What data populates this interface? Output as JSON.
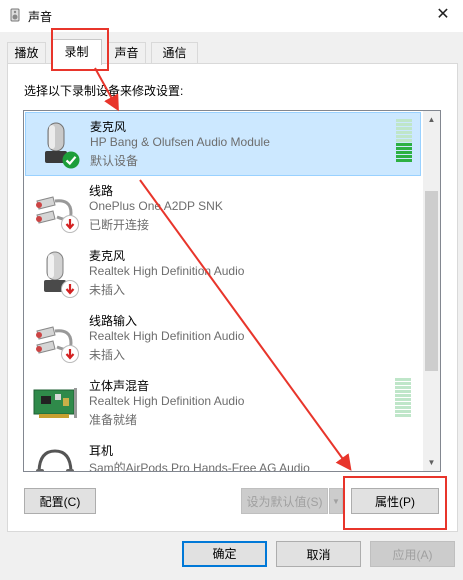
{
  "window": {
    "title": "声音",
    "close_glyph": "✕"
  },
  "tabs": [
    {
      "label": "播放"
    },
    {
      "label": "录制"
    },
    {
      "label": "声音"
    },
    {
      "label": "通信"
    }
  ],
  "instruction": "选择以下录制设备来修改设置:",
  "devices": [
    {
      "name": "麦克风",
      "description": "HP Bang & Olufsen Audio Module",
      "status": "默认设备",
      "icon": "microphone-icon",
      "badge": "check-badge-icon",
      "selected": true,
      "meter_level": 0.4
    },
    {
      "name": "线路",
      "description": "OnePlus One A2DP SNK",
      "status": "已断开连接",
      "icon": "line-in-icon",
      "badge": "down-arrow-badge-icon",
      "selected": false
    },
    {
      "name": "麦克风",
      "description": "Realtek High Definition Audio",
      "status": "未插入",
      "icon": "microphone-icon",
      "badge": "down-arrow-badge-icon",
      "selected": false
    },
    {
      "name": "线路输入",
      "description": "Realtek High Definition Audio",
      "status": "未插入",
      "icon": "line-in-icon",
      "badge": "down-arrow-badge-icon",
      "selected": false
    },
    {
      "name": "立体声混音",
      "description": "Realtek High Definition Audio",
      "status": "准备就绪",
      "icon": "sound-card-icon",
      "badge": "",
      "selected": false,
      "meter_level": 0
    },
    {
      "name": "耳机",
      "description": "Sam的AirPods Pro Hands-Free AG Audio",
      "status": "",
      "icon": "headset-icon",
      "badge": "",
      "selected": false
    }
  ],
  "buttons": {
    "configure": "配置(C)",
    "set_default": "设为默认值(S)",
    "properties": "属性(P)",
    "ok": "确定",
    "cancel": "取消",
    "apply": "应用(A)"
  },
  "colors": {
    "annotation": "#e8352b",
    "selection": "#cce8ff",
    "meter_active": "#2db042"
  }
}
